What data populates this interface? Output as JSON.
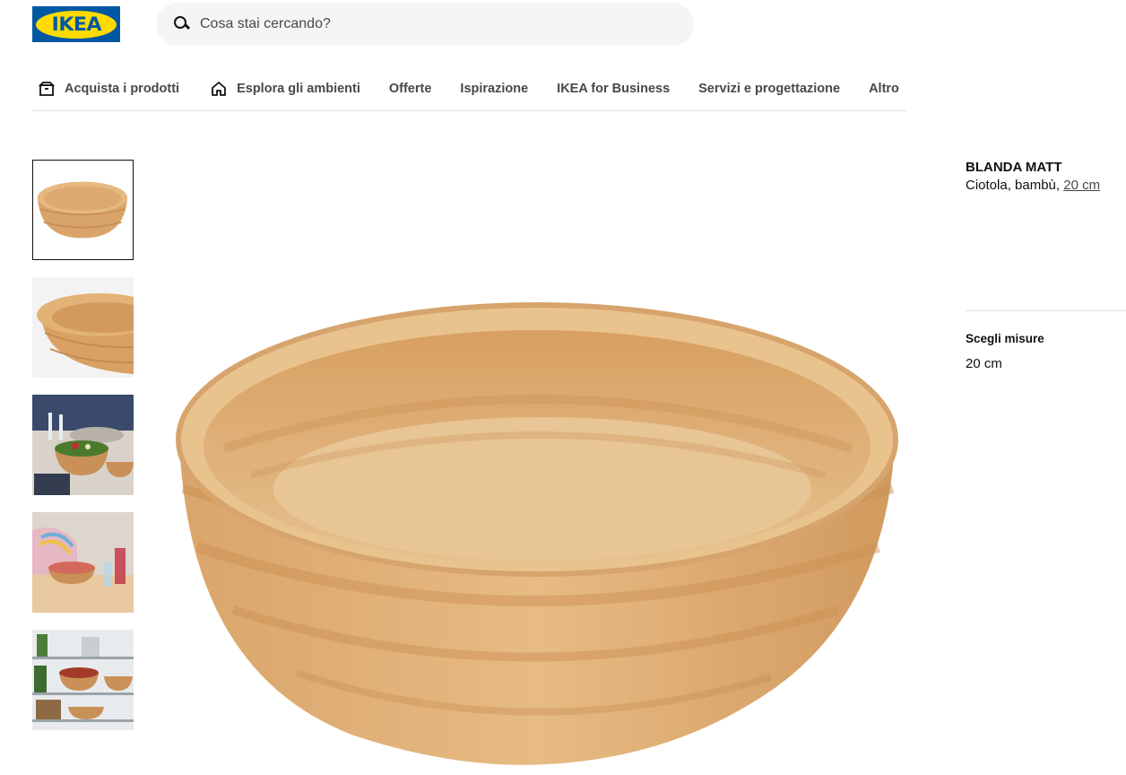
{
  "header": {
    "logo_text": "IKEA",
    "search_placeholder": "Cosa stai cercando?"
  },
  "nav": {
    "items": [
      {
        "label": "Acquista i prodotti",
        "icon": "box-icon"
      },
      {
        "label": "Esplora gli ambienti",
        "icon": "home-icon"
      },
      {
        "label": "Offerte"
      },
      {
        "label": "Ispirazione"
      },
      {
        "label": "IKEA for Business"
      },
      {
        "label": "Servizi e progettazione"
      },
      {
        "label": "Altro"
      }
    ]
  },
  "gallery": {
    "selected_index": 0,
    "thumbnails": [
      "bowl-front",
      "bowl-closeup",
      "table-setting",
      "living-room-table",
      "kitchen-shelf"
    ]
  },
  "product": {
    "name": "BLANDA MATT",
    "description_prefix": "Ciotola, bambù, ",
    "size_link": "20 cm",
    "size_label": "Scegli misure",
    "size_value": "20 cm"
  },
  "colors": {
    "brand_blue": "#0058a3",
    "brand_yellow": "#ffdb00",
    "text_primary": "#111111",
    "text_secondary": "#484848"
  }
}
